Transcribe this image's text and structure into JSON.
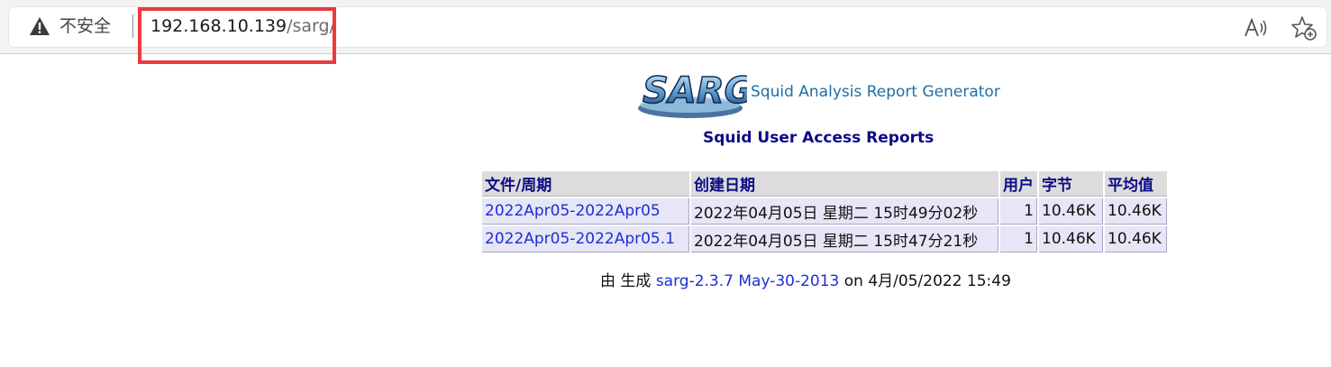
{
  "browser": {
    "security_label": "不安全",
    "url_host": "192.168.10.139",
    "url_path": "/sarg/",
    "icons": [
      "warning-icon",
      "read-aloud-icon",
      "add-favorite-icon"
    ],
    "highlight_color": "#ec3a3f"
  },
  "page": {
    "logo_text": "SARG",
    "generator": "Squid Analysis Report Generator",
    "title": "Squid User Access Reports",
    "table": {
      "headers": [
        "文件/周期",
        "创建日期",
        "用户",
        "字节",
        "平均值"
      ],
      "rows": [
        [
          "2022Apr05-2022Apr05",
          "2022年04月05日 星期二 15时49分02秒",
          "1",
          "10.46K",
          "10.46K"
        ],
        [
          "2022Apr05-2022Apr05.1",
          "2022年04月05日 星期二 15时47分21秒",
          "1",
          "10.46K",
          "10.46K"
        ]
      ]
    },
    "footer": {
      "prefix": "由 生成",
      "version": "sarg-2.3.7 May-30-2013",
      "suffix": "on 4月/05/2022 15:49"
    }
  }
}
